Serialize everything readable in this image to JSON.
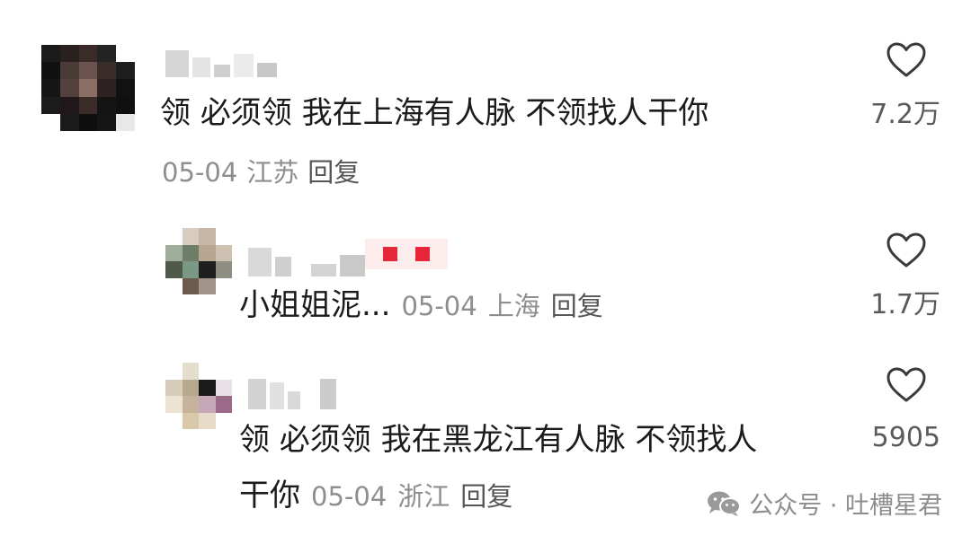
{
  "comments": [
    {
      "text": "领 必须领 我在上海有人脉 不领找人干你",
      "date": "05-04",
      "location": "江苏",
      "reply_label": "回复",
      "likes": "7.2万"
    }
  ],
  "replies": [
    {
      "text": "小姐姐泥...",
      "date": "05-04",
      "location": "上海",
      "reply_label": "回复",
      "likes": "1.7万"
    },
    {
      "text_line1": "领 必须领 我在黑龙江有人脉 不领找人",
      "text_line2": "干你",
      "date": "05-04",
      "location": "浙江",
      "reply_label": "回复",
      "likes": "5905"
    }
  ],
  "watermark": {
    "icon": "wechat-icon",
    "text": "公众号 · 吐槽星君"
  },
  "colors": {
    "text": "#1b1b1b",
    "meta": "#8e8e8e",
    "heart_stroke": "#3a3a3a",
    "badge_red": "#e8263a"
  }
}
